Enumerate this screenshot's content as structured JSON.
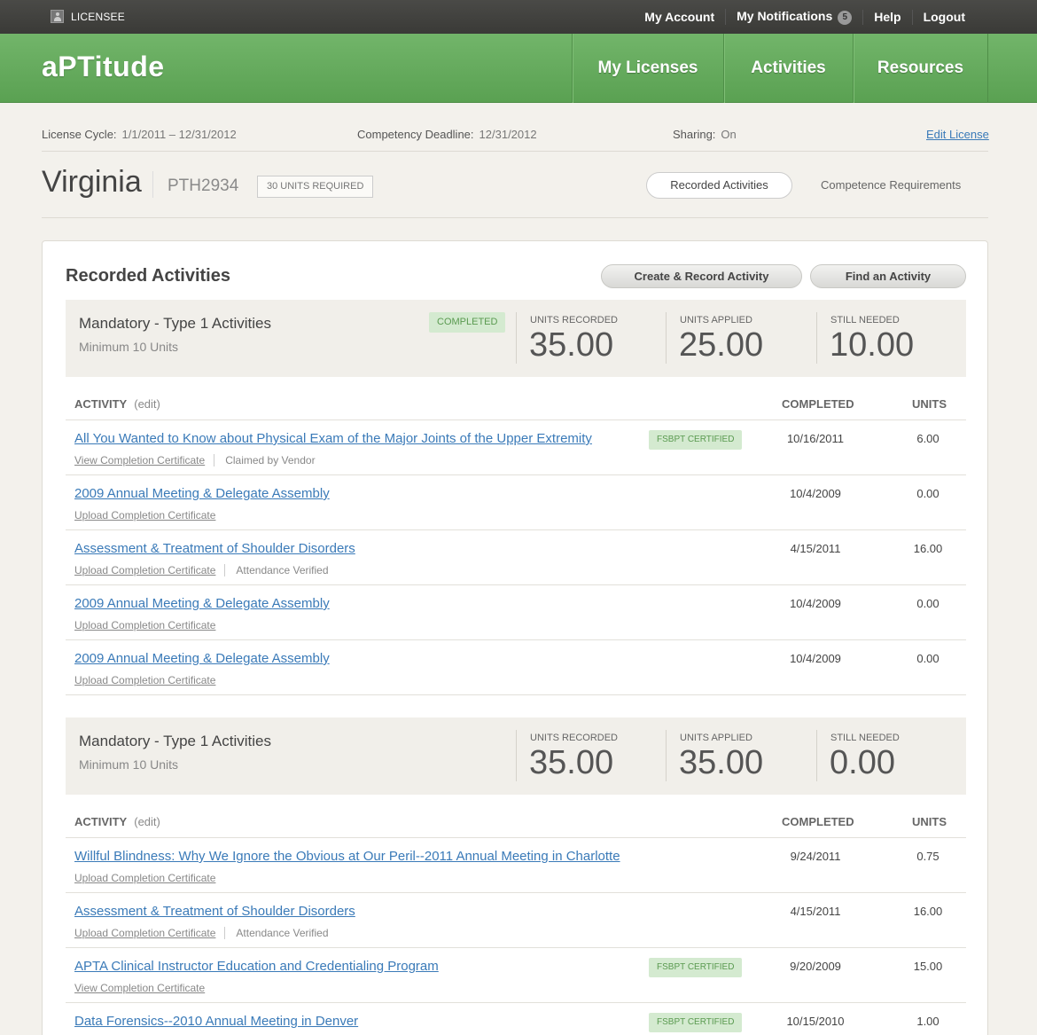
{
  "topbar": {
    "licensee": "LICENSEE",
    "links": [
      "My Account",
      "My Notifications",
      "Help",
      "Logout"
    ],
    "notification_count": "5"
  },
  "header": {
    "logo": "aPTitude",
    "nav": [
      "My Licenses",
      "Activities",
      "Resources"
    ]
  },
  "license": {
    "cycle_label": "License Cycle:",
    "cycle_value": "1/1/2011 – 12/31/2012",
    "deadline_label": "Competency Deadline:",
    "deadline_value": "12/31/2012",
    "sharing_label": "Sharing:",
    "sharing_value": "On",
    "edit_link": "Edit License",
    "state": "Virginia",
    "number": "PTH2934",
    "units_required": "30 UNITS REQUIRED",
    "tabs": [
      "Recorded Activities",
      "Competence Requirements"
    ]
  },
  "card": {
    "title": "Recorded Activities",
    "create_button": "Create & Record Activity",
    "find_button": "Find an Activity"
  },
  "groups": [
    {
      "title": "Mandatory - Type 1 Activities",
      "subtitle": "Minimum 10 Units",
      "badge": "COMPLETED",
      "stats": [
        {
          "label": "UNITS RECORDED",
          "value": "35.00"
        },
        {
          "label": "UNITS APPLIED",
          "value": "25.00"
        },
        {
          "label": "STILL NEEDED",
          "value": "10.00"
        }
      ],
      "columns": {
        "activity": "ACTIVITY",
        "edit": "(edit)",
        "completed": "COMPLETED",
        "units": "UNITS"
      },
      "rows": [
        {
          "title": "All You Wanted to Know about Physical Exam of the Major Joints of the Upper Extremity",
          "cert": "View Completion Certificate",
          "note": "Claimed by Vendor",
          "badge": "FSBPT CERTIFIED",
          "date": "10/16/2011",
          "units": "6.00"
        },
        {
          "title": "2009 Annual Meeting & Delegate Assembly",
          "cert": "Upload Completion Certificate",
          "note": "",
          "badge": "",
          "date": "10/4/2009",
          "units": "0.00"
        },
        {
          "title": "Assessment & Treatment of Shoulder Disorders",
          "cert": "Upload Completion Certificate",
          "note": "Attendance Verified",
          "badge": "",
          "date": "4/15/2011",
          "units": "16.00"
        },
        {
          "title": "2009 Annual Meeting & Delegate Assembly",
          "cert": "Upload Completion Certificate",
          "note": "",
          "badge": "",
          "date": "10/4/2009",
          "units": "0.00"
        },
        {
          "title": "2009 Annual Meeting & Delegate Assembly",
          "cert": "Upload Completion Certificate",
          "note": "",
          "badge": "",
          "date": "10/4/2009",
          "units": "0.00"
        }
      ]
    },
    {
      "title": "Mandatory - Type 1 Activities",
      "subtitle": "Minimum 10 Units",
      "badge": "",
      "stats": [
        {
          "label": "UNITS RECORDED",
          "value": "35.00"
        },
        {
          "label": "UNITS APPLIED",
          "value": "35.00"
        },
        {
          "label": "STILL NEEDED",
          "value": "0.00"
        }
      ],
      "columns": {
        "activity": "ACTIVITY",
        "edit": "(edit)",
        "completed": "COMPLETED",
        "units": "UNITS"
      },
      "rows": [
        {
          "title": "Willful Blindness: Why We Ignore the Obvious at Our Peril--2011 Annual Meeting in Charlotte",
          "cert": "Upload Completion Certificate",
          "note": "",
          "badge": "",
          "date": "9/24/2011",
          "units": "0.75"
        },
        {
          "title": "Assessment & Treatment of Shoulder Disorders",
          "cert": "Upload Completion Certificate",
          "note": "Attendance Verified",
          "badge": "",
          "date": "4/15/2011",
          "units": "16.00"
        },
        {
          "title": "APTA Clinical Instructor Education and Credentialing Program",
          "cert": "View Completion Certificate",
          "note": "",
          "badge": "FSBPT CERTIFIED",
          "date": "9/20/2009",
          "units": "15.00"
        },
        {
          "title": "Data Forensics--2010 Annual Meeting in Denver",
          "cert": "",
          "note": "",
          "badge": "FSBPT CERTIFIED",
          "date": "10/15/2010",
          "units": "1.00"
        }
      ]
    }
  ]
}
